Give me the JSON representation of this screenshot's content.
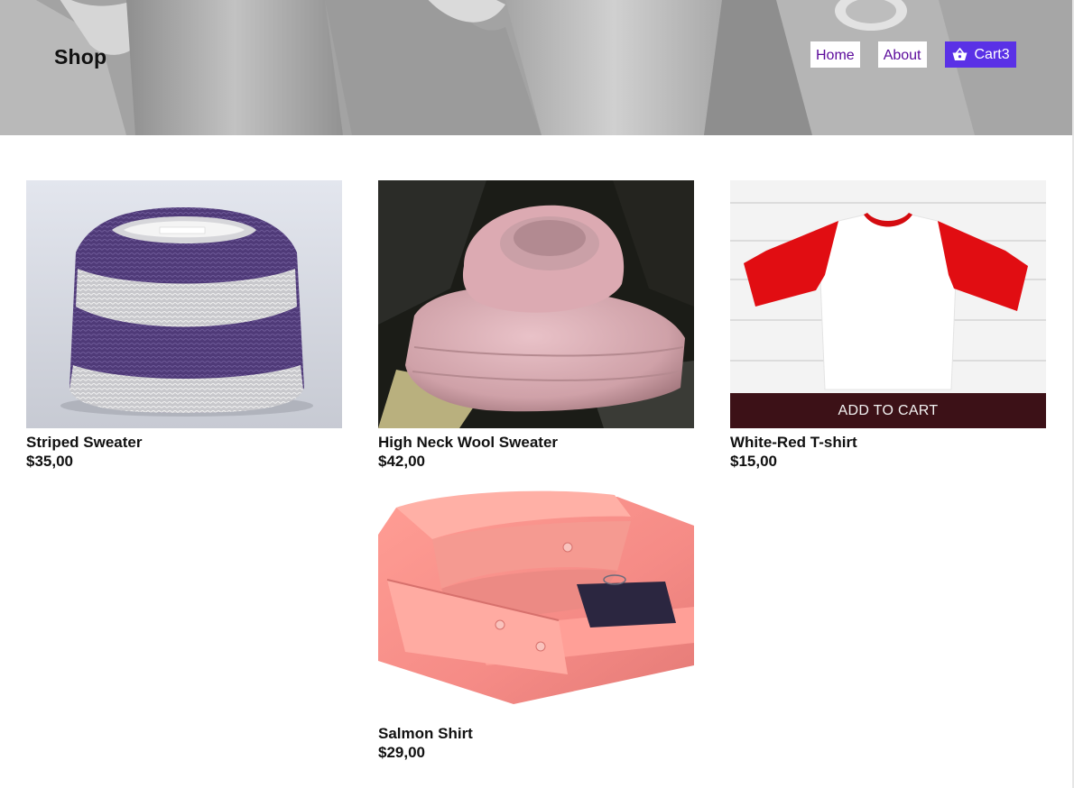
{
  "header": {
    "brand": "Shop",
    "nav": {
      "home": "Home",
      "about": "About",
      "cart": "Cart",
      "cart_count": "3",
      "cart_icon": "basket-icon"
    }
  },
  "colors": {
    "accent": "#5a31e6",
    "nav_text": "#5b0a9b",
    "add_to_cart_bg": "#3c1117"
  },
  "products": [
    {
      "name": "Striped Sweater",
      "price": "$35,00",
      "image": "purple-white-striped-sweater"
    },
    {
      "name": "High Neck Wool Sweater",
      "price": "$42,00",
      "image": "pink-high-neck-sweater"
    },
    {
      "name": "White-Red T-shirt",
      "price": "$15,00",
      "image": "white-red-raglan-tshirt",
      "add_to_cart": "ADD TO CART"
    },
    {
      "name": "Salmon Shirt",
      "price": "$29,00",
      "image": "salmon-dress-shirt"
    }
  ]
}
